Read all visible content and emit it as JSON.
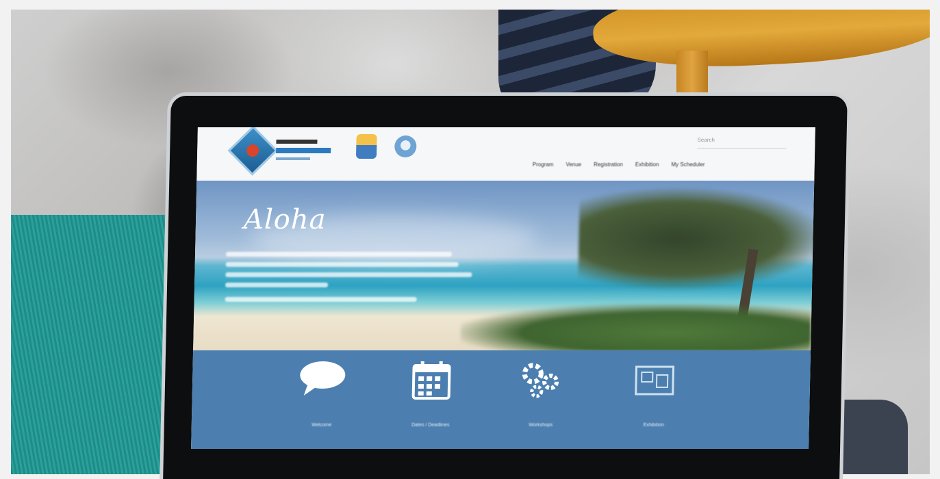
{
  "website": {
    "search_placeholder": "Search",
    "nav": [
      "Program",
      "Venue",
      "Registration",
      "Exhibition",
      "My Scheduler"
    ],
    "hero_title": "Aloha",
    "features": [
      {
        "icon": "speech-bubble-icon",
        "label": "Welcome"
      },
      {
        "icon": "calendar-icon",
        "label": "Dates / Deadlines"
      },
      {
        "icon": "gears-icon",
        "label": "Workshops"
      },
      {
        "icon": "exhibition-icon",
        "label": "Exhibition"
      }
    ]
  },
  "colors": {
    "feature_band": "#4c7fb0",
    "laptop_bezel": "#0d0e10",
    "chair": "#e3a93a",
    "couch": "#2aa19c"
  }
}
